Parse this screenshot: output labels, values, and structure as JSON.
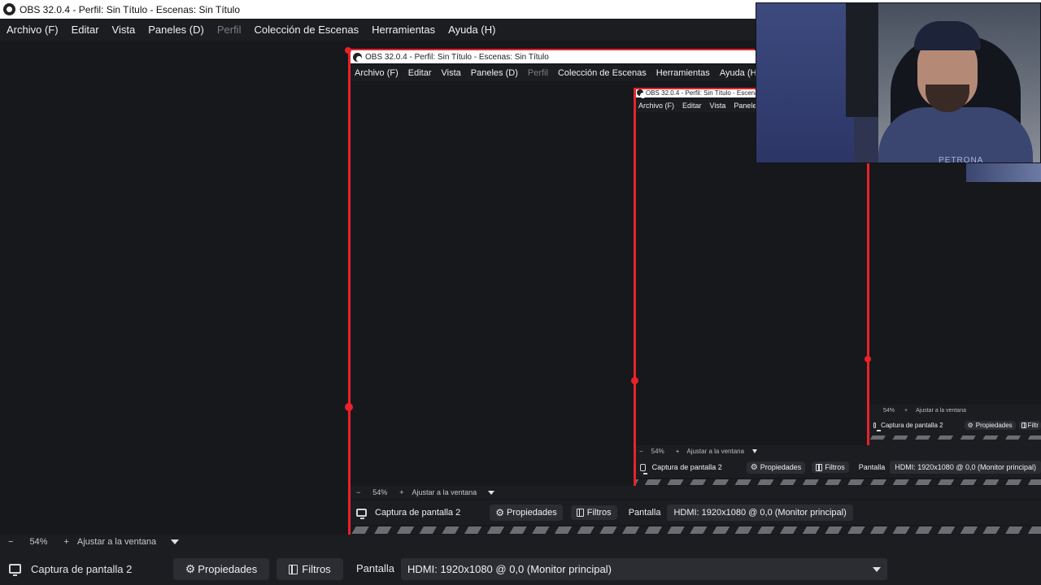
{
  "window": {
    "title": "OBS 32.0.4 - Perfil: Sin Título - Escenas: Sin Título"
  },
  "menu": {
    "items": [
      {
        "label": "Archivo (F)",
        "enabled": true
      },
      {
        "label": "Editar",
        "enabled": true
      },
      {
        "label": "Vista",
        "enabled": true
      },
      {
        "label": "Paneles (D)",
        "enabled": true
      },
      {
        "label": "Perfil",
        "enabled": false
      },
      {
        "label": "Colección de Escenas",
        "enabled": true
      },
      {
        "label": "Herramientas",
        "enabled": true
      },
      {
        "label": "Ayuda (H)",
        "enabled": true
      }
    ],
    "items_truncated_small": [
      "Archivo (F)",
      "Editar",
      "Vista",
      "Paneles"
    ]
  },
  "zoom": {
    "minus": "−",
    "value": "54%",
    "plus": "+",
    "fit_label": "Ajustar a la ventana"
  },
  "source_bar": {
    "source_name": "Captura de pantalla 2",
    "properties_label": "Propiedades",
    "filters_label": "Filtros",
    "filters_label_cut": "Filtr",
    "display_label": "Pantalla",
    "display_value": "HDMI: 1920x1080 @ 0,0 (Monitor principal)"
  },
  "webcam": {
    "shirt_text": "PETRONA"
  },
  "colors": {
    "background": "#1c1d21",
    "preview": "#17181c",
    "button": "#2b2d33",
    "selection_red": "#e8222a",
    "titlebar": "#ffffff"
  }
}
